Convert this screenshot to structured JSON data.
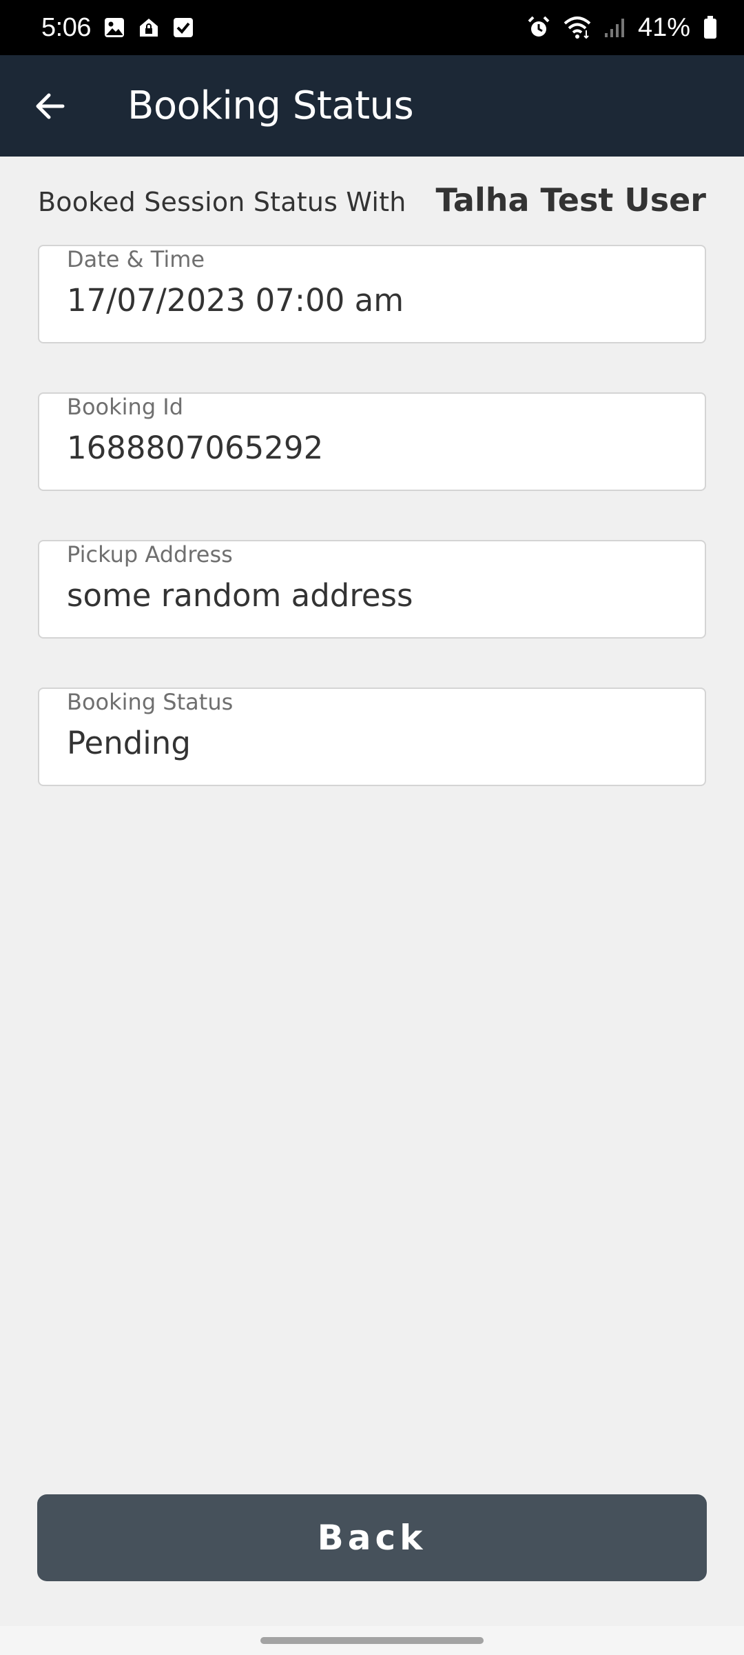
{
  "status_bar": {
    "time": "5:06",
    "left_icons": [
      "gallery-icon",
      "home-lock-icon",
      "checkbox-icon"
    ],
    "right_icons": [
      "alarm-icon",
      "wifi-icon",
      "signal-icon",
      "battery-icon"
    ],
    "battery_percent": "41%"
  },
  "app_bar": {
    "title": "Booking Status",
    "back_icon": "arrow-left-icon"
  },
  "session": {
    "prefix": "Booked Session Status With",
    "user_name": "Talha Test User"
  },
  "fields": [
    {
      "label": "Date & Time",
      "value": "17/07/2023 07:00 am"
    },
    {
      "label": "Booking Id",
      "value": "1688807065292"
    },
    {
      "label": "Pickup Address",
      "value": "some random address"
    },
    {
      "label": "Booking Status",
      "value": "Pending"
    }
  ],
  "back_button": {
    "label": "Back"
  },
  "colors": {
    "app_bar": "#1c2836",
    "background": "#f0f0f0",
    "button": "#46515b"
  }
}
